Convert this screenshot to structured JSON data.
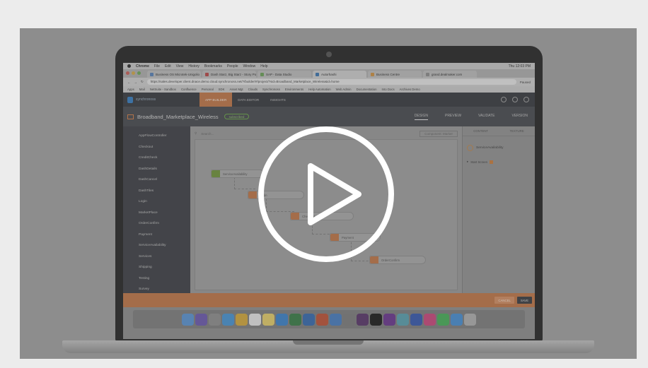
{
  "video": {
    "play_label": ""
  },
  "menubar": {
    "items": [
      "Chrome",
      "File",
      "Edit",
      "View",
      "History",
      "Bookmarks",
      "People",
      "Window",
      "Help"
    ],
    "clock": "Thu 12:03 PM"
  },
  "browser": {
    "tabs": [
      {
        "label": "Business OS Microtek-Unigolio",
        "fav_color": "#5a7fb0"
      },
      {
        "label": "Dash Starz, Big Starz - Story Por…",
        "fav_color": "#b04a4a"
      },
      {
        "label": "SAP - Data Studio",
        "fav_color": "#6b9c5a"
      },
      {
        "label": "Autorhashi",
        "fav_color": "#3f73a8",
        "active": true
      },
      {
        "label": "Business Centre",
        "fav_color": "#c48d45"
      },
      {
        "label": "grand.dealmaker.com",
        "fav_color": "#888888"
      }
    ],
    "url": "https://sales.developer.client.dnace.demo.cloud.synchronoss.net/?/builder/#/project/?sid=Broadband_Marketplace_Wireless&id=home",
    "bookmarks": [
      "Apps",
      "Mail",
      "NetSuite - Sandbox",
      "Confluence",
      "Personal",
      "SDK",
      "Asset Mgt",
      "Clouds",
      "Synchronoss",
      "Environments",
      "Help Automation",
      "Web Admin",
      "Documentation",
      "Into Docs",
      "Archives Demo"
    ],
    "profile": "Paused"
  },
  "app": {
    "brand": "synchronoss",
    "top_tabs": [
      {
        "label": "APP BUILDER",
        "active": true
      },
      {
        "label": "DATA EDITOR",
        "active": false
      },
      {
        "label": "INSIGHTS",
        "active": false
      }
    ],
    "project_name": "Broadband_Marketplace_Wireless",
    "project_status": "subscribed",
    "header_tabs": [
      {
        "label": "DESIGN",
        "active": true
      },
      {
        "label": "PREVIEW",
        "active": false
      },
      {
        "label": "VALIDATE",
        "active": false
      },
      {
        "label": "VERSION",
        "active": false
      }
    ],
    "sidebar_items": [
      "AppFlowController",
      "Checkout",
      "CreditCheck",
      "DashDetails",
      "DashCancel",
      "DashTiles",
      "Login",
      "MarketPlace",
      "OrderConfirm",
      "Payment",
      "ServiceAvailability",
      "Services",
      "Shipping",
      "Testing",
      "Survey"
    ],
    "canvas": {
      "search_placeholder": "Search...",
      "zoom_label": "Component: Marker"
    },
    "nodes": [
      {
        "label": "ServiceAvailability",
        "cap_color": "#6e8f3d"
      },
      {
        "label": "Login",
        "cap_color": "#b8744a"
      },
      {
        "label": "Checkout",
        "cap_color": "#b8744a"
      },
      {
        "label": "Payment",
        "cap_color": "#b8744a"
      },
      {
        "label": "OrderConfirm",
        "cap_color": "#b8744a"
      }
    ],
    "right_panel": {
      "tabs": [
        "CONTENT",
        "TEXTURE"
      ],
      "node_name": "ServiceAvailability",
      "row_label": "Start Screen"
    },
    "footer": {
      "cancel_label": "CANCEL",
      "save_label": "SAVE"
    }
  },
  "dock": {
    "icons": [
      {
        "name": "finder-icon",
        "color": "#5b8fc9"
      },
      {
        "name": "siri-icon",
        "color": "#6b5aa8"
      },
      {
        "name": "launchpad-icon",
        "color": "#8a8a8a"
      },
      {
        "name": "safari-icon",
        "color": "#4a8fc9"
      },
      {
        "name": "chrome-icon",
        "color": "#c9a23f"
      },
      {
        "name": "calendar-icon",
        "color": "#d9d9d9"
      },
      {
        "name": "notes-icon",
        "color": "#d8c46a"
      },
      {
        "name": "app-store-icon",
        "color": "#3f7fc0"
      },
      {
        "name": "excel-icon",
        "color": "#3c7a4a"
      },
      {
        "name": "outlook-icon",
        "color": "#3a6aa8"
      },
      {
        "name": "powerpoint-icon",
        "color": "#b5533a"
      },
      {
        "name": "keynote-icon",
        "color": "#4a7ab8"
      },
      {
        "name": "preferences-icon",
        "color": "#7a7a7a"
      },
      {
        "name": "slack-icon",
        "color": "#5a3a6a"
      },
      {
        "name": "terminal-icon",
        "color": "#222222"
      },
      {
        "name": "onenote-icon",
        "color": "#6a3a8a"
      },
      {
        "name": "camera-icon",
        "color": "#5a9aa8"
      },
      {
        "name": "word-icon",
        "color": "#3a5aa8"
      },
      {
        "name": "itunes-icon",
        "color": "#c04a7a"
      },
      {
        "name": "facetime-icon",
        "color": "#4aa85a"
      },
      {
        "name": "downloads-icon",
        "color": "#4a8ac9"
      },
      {
        "name": "trash-icon",
        "color": "#a8a8a8"
      }
    ]
  }
}
